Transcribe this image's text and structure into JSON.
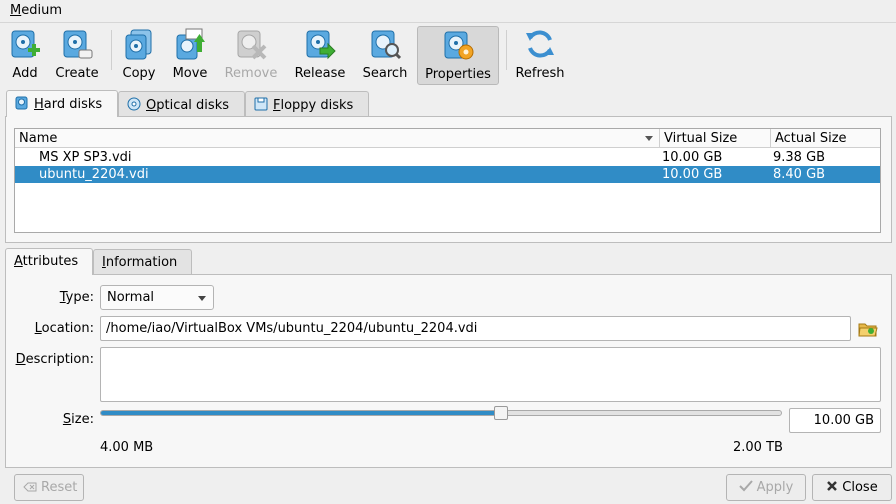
{
  "menu": {
    "label": "Medium"
  },
  "toolbar": {
    "items": [
      {
        "label": "Add",
        "icon": "add-disk-icon",
        "enabled": true
      },
      {
        "label": "Create",
        "icon": "create-disk-icon",
        "enabled": true
      },
      {
        "label": "Copy",
        "icon": "copy-disk-icon",
        "enabled": true
      },
      {
        "label": "Move",
        "icon": "move-disk-icon",
        "enabled": true
      },
      {
        "label": "Remove",
        "icon": "remove-disk-icon",
        "enabled": false
      },
      {
        "label": "Release",
        "icon": "release-disk-icon",
        "enabled": true
      },
      {
        "label": "Search",
        "icon": "search-disk-icon",
        "enabled": true
      },
      {
        "label": "Properties",
        "icon": "properties-disk-icon",
        "enabled": true,
        "active": true
      },
      {
        "label": "Refresh",
        "icon": "refresh-icon",
        "enabled": true
      }
    ]
  },
  "media_tabs": [
    {
      "label": "Hard disks",
      "icon": "hard-disk-icon",
      "selected": true
    },
    {
      "label": "Optical disks",
      "icon": "optical-disk-icon",
      "selected": false
    },
    {
      "label": "Floppy disks",
      "icon": "floppy-disk-icon",
      "selected": false
    }
  ],
  "table": {
    "columns": [
      "Name",
      "Virtual Size",
      "Actual Size"
    ],
    "rows": [
      {
        "name": "MS XP SP3.vdi",
        "virtual": "10.00 GB",
        "actual": "9.38 GB",
        "selected": false
      },
      {
        "name": "ubuntu_2204.vdi",
        "virtual": "10.00 GB",
        "actual": "8.40 GB",
        "selected": true
      }
    ]
  },
  "detail_tabs": [
    {
      "label": "Attributes",
      "selected": true
    },
    {
      "label": "Information",
      "selected": false
    }
  ],
  "attributes": {
    "type_label": "Type:",
    "type_value": "Normal",
    "location_label": "Location:",
    "location_value": "/home/iao/VirtualBox VMs/ubuntu_2204/ubuntu_2204.vdi",
    "description_label": "Description:",
    "description_value": "",
    "size_label": "Size:",
    "size_value": "10.00 GB",
    "size_min": "4.00 MB",
    "size_max": "2.00 TB",
    "slider_fraction": 0.59
  },
  "buttons": {
    "reset": "Reset",
    "apply": "Apply",
    "close": "Close"
  },
  "colors": {
    "selection": "#308cc6",
    "window_bg": "#efefef"
  }
}
